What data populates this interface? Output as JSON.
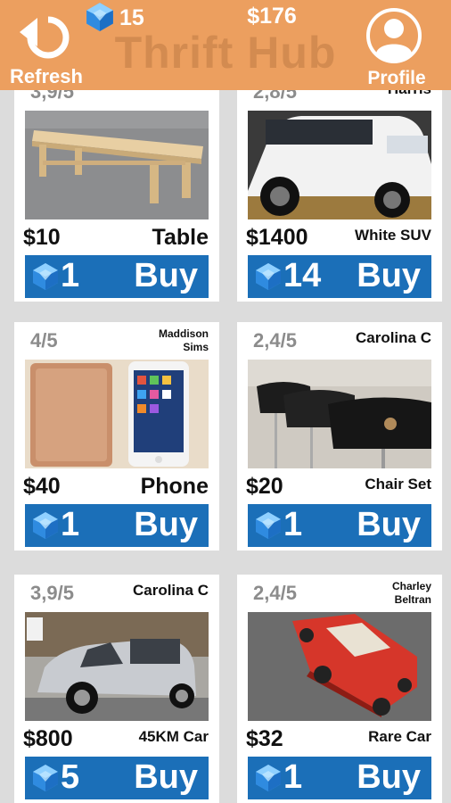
{
  "header": {
    "title": "Thrift Hub",
    "refresh_label": "Refresh",
    "profile_label": "Profile",
    "gems": "15",
    "money": "$176",
    "color": "#ec9f5f"
  },
  "listings": [
    {
      "rating": "3,9/5",
      "seller": "",
      "price": "$10",
      "name": "Table",
      "gem_cost": "1",
      "buy_label": "Buy",
      "image": "wooden table"
    },
    {
      "rating": "2,8/5",
      "seller": "Harris",
      "price": "$1400",
      "name": "White SUV",
      "gem_cost": "14",
      "buy_label": "Buy",
      "image": "white suv"
    },
    {
      "rating": "4/5",
      "seller_line1": "Maddison",
      "seller_line2": "Sims",
      "price": "$40",
      "name": "Phone",
      "gem_cost": "1",
      "buy_label": "Buy",
      "image": "phone and box"
    },
    {
      "rating": "2,4/5",
      "seller": "Carolina C",
      "price": "$20",
      "name": "Chair Set",
      "gem_cost": "1",
      "buy_label": "Buy",
      "image": "black chairs"
    },
    {
      "rating": "3,9/5",
      "seller": "Carolina C",
      "price": "$800",
      "name": "45KM Car",
      "gem_cost": "5",
      "buy_label": "Buy",
      "image": "silver microcar"
    },
    {
      "rating": "2,4/5",
      "seller_line1": "Charley",
      "seller_line2": "Beltran",
      "price": "$32",
      "name": "Rare Car",
      "gem_cost": "1",
      "buy_label": "Buy",
      "image": "red toy car"
    }
  ],
  "colors": {
    "buy_button": "#1b6fb8",
    "card": "#ffffff",
    "background": "#dcdcdc",
    "gem": "#2f8be0"
  }
}
